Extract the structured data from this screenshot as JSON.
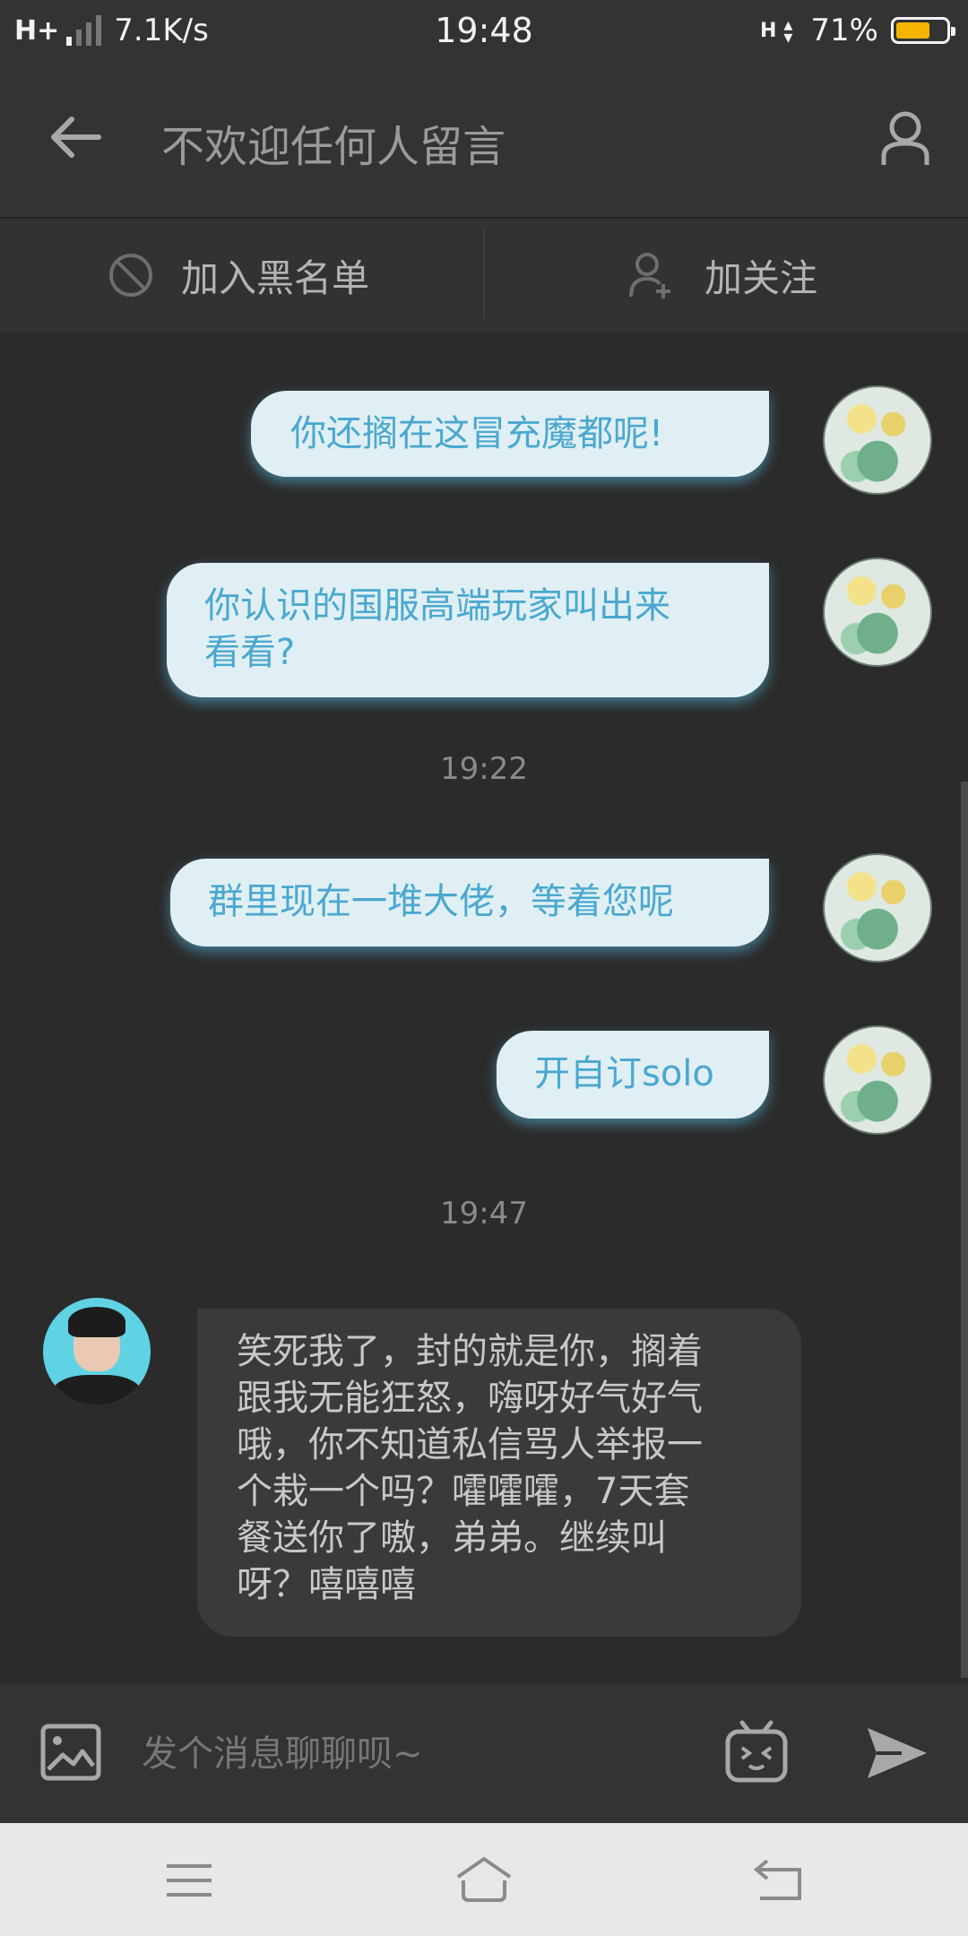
{
  "status_bar": {
    "network_type": "H+",
    "speed": "7.1K/s",
    "time": "19:48",
    "battery": "71%",
    "battery_level": 0.71,
    "battery_color": "#f5b400"
  },
  "header": {
    "title": "不欢迎任何人留言",
    "back_icon": "arrow-left-icon",
    "profile_icon": "user-profile-icon"
  },
  "actions": {
    "block_label": "加入黑名单",
    "block_icon": "block-circle-icon",
    "follow_label": "加关注",
    "follow_icon": "add-user-icon"
  },
  "messages": {
    "outgoing_1": "你还搁在这冒充魔都呢!",
    "outgoing_2_line1": "你认识的国服高端玩家叫出来",
    "outgoing_2_line2": "看看?",
    "time_1": "19:22",
    "outgoing_3": "群里现在一堆大佬，等着您呢",
    "outgoing_4": "开自订solo",
    "time_2": "19:47",
    "incoming_lines": [
      "笑死我了，封的就是你，搁着",
      "跟我无能狂怒，嗨呀好气好气",
      "哦，你不知道私信骂人举报一",
      "个栽一个吗？嚯嚯嚯，7天套",
      "餐送你了嗷，弟弟。继续叫",
      "呀？嘻嘻嘻"
    ]
  },
  "composer": {
    "placeholder": "发个消息聊聊呗~",
    "image_icon": "image-icon",
    "emoji_icon": "emoji-tv-icon",
    "send_icon": "send-icon"
  },
  "colors": {
    "outgoing_bubble": "#e0eff4",
    "outgoing_text": "#4aa8cf",
    "incoming_bubble": "#3a3a3a",
    "background": "#2b2b2b"
  }
}
